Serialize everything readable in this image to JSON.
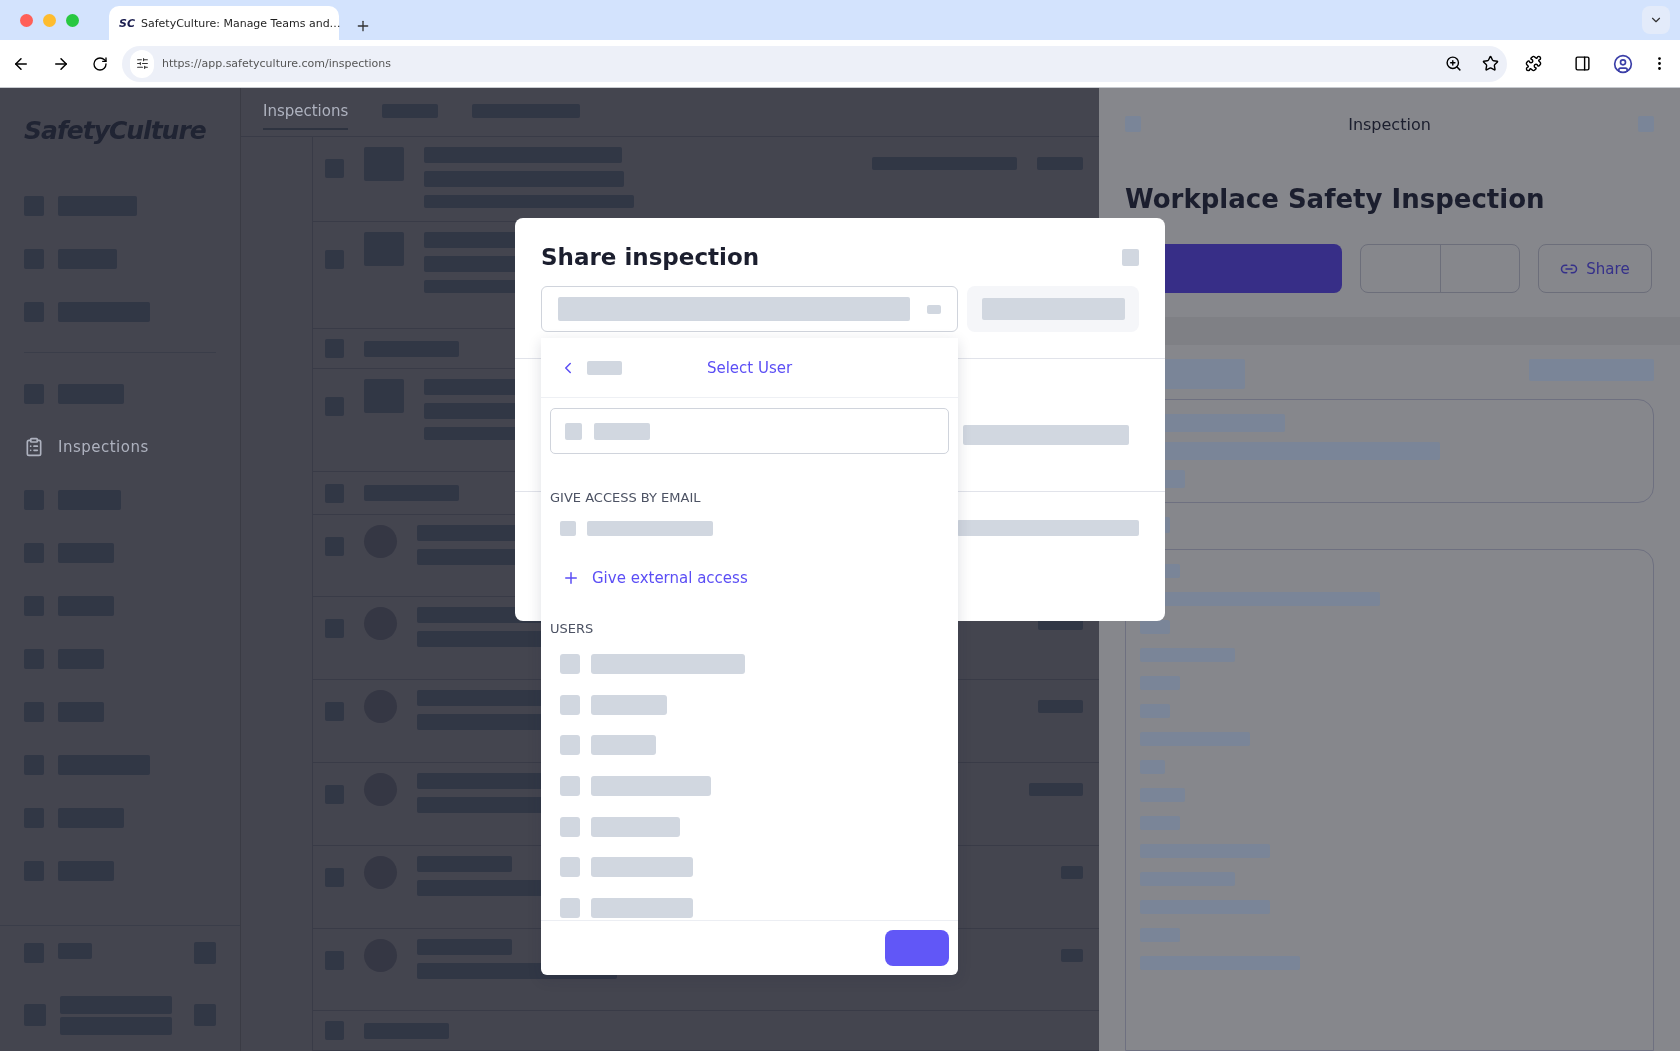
{
  "browser": {
    "favicon": "SC",
    "tab_title": "SafetyCulture: Manage Teams and…",
    "url": "https://app.safetyculture.com/inspections"
  },
  "sidebar": {
    "logo": "SafetyCulture",
    "items": [
      {
        "kind": "redacted"
      },
      {
        "kind": "redacted"
      },
      {
        "kind": "redacted"
      },
      {
        "kind": "divider"
      },
      {
        "kind": "redacted"
      },
      {
        "kind": "link",
        "label": "Inspections"
      },
      {
        "kind": "redacted"
      },
      {
        "kind": "redacted"
      },
      {
        "kind": "redacted"
      },
      {
        "kind": "redacted"
      },
      {
        "kind": "redacted"
      },
      {
        "kind": "redacted"
      },
      {
        "kind": "redacted"
      },
      {
        "kind": "redacted"
      }
    ]
  },
  "main": {
    "tabs": [
      {
        "kind": "text",
        "label": "Inspections",
        "selected": true
      },
      {
        "kind": "redacted",
        "selected": false
      },
      {
        "kind": "redacted",
        "selected": false
      }
    ]
  },
  "inspection_panel": {
    "header": "Inspection",
    "title": "Workplace Safety Inspection",
    "share_button": "Share"
  },
  "share_dialog": {
    "title": "Share inspection",
    "dropdown": {
      "title": "Select User",
      "sections": [
        {
          "heading": "GIVE ACCESS BY EMAIL",
          "action": "Give external access"
        },
        {
          "heading": "USERS"
        }
      ]
    }
  }
}
